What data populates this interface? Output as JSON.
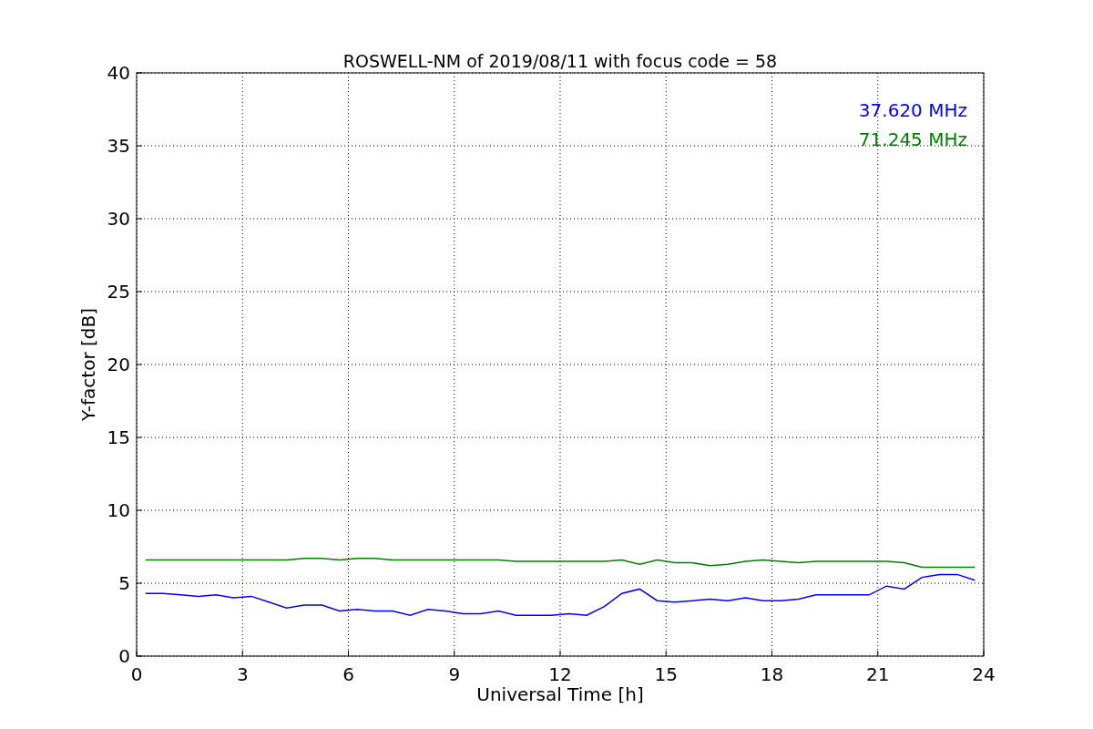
{
  "chart_data": {
    "type": "line",
    "title": "ROSWELL-NM of 2019/08/11 with focus code = 58",
    "xlabel": "Universal Time [h]",
    "ylabel": "Y-factor [dB]",
    "x": [
      0.25,
      0.75,
      1.25,
      1.75,
      2.25,
      2.75,
      3.25,
      3.75,
      4.25,
      4.75,
      5.25,
      5.75,
      6.25,
      6.75,
      7.25,
      7.75,
      8.25,
      8.75,
      9.25,
      9.75,
      10.25,
      10.75,
      11.25,
      11.75,
      12.25,
      12.75,
      13.25,
      13.75,
      14.25,
      14.75,
      15.25,
      15.75,
      16.25,
      16.75,
      17.25,
      17.75,
      18.25,
      18.75,
      19.25,
      20.75,
      21.25,
      21.75,
      22.25,
      22.75,
      23.25,
      23.75
    ],
    "series": [
      {
        "name": "37.620 MHz",
        "color": "#0000ff",
        "values": [
          4.3,
          4.3,
          4.2,
          4.1,
          4.2,
          4.0,
          4.1,
          3.7,
          3.3,
          3.5,
          3.5,
          3.1,
          3.2,
          3.1,
          3.1,
          2.8,
          3.2,
          3.1,
          2.9,
          2.9,
          3.1,
          2.8,
          2.8,
          2.8,
          2.9,
          2.8,
          3.4,
          4.3,
          4.6,
          3.8,
          3.7,
          3.8,
          3.9,
          3.8,
          4.0,
          3.8,
          3.8,
          3.9,
          4.2,
          4.2,
          4.8,
          4.6,
          5.4,
          5.6,
          5.6,
          5.2
        ]
      },
      {
        "name": "71.245 MHz",
        "color": "#008000",
        "values": [
          6.6,
          6.6,
          6.6,
          6.6,
          6.6,
          6.6,
          6.6,
          6.6,
          6.6,
          6.7,
          6.7,
          6.6,
          6.7,
          6.7,
          6.6,
          6.6,
          6.6,
          6.6,
          6.6,
          6.6,
          6.6,
          6.5,
          6.5,
          6.5,
          6.5,
          6.5,
          6.5,
          6.6,
          6.3,
          6.6,
          6.4,
          6.4,
          6.2,
          6.3,
          6.5,
          6.6,
          6.5,
          6.4,
          6.5,
          6.5,
          6.5,
          6.4,
          6.1,
          6.1,
          6.1,
          6.1
        ]
      }
    ],
    "xlim": [
      0,
      24
    ],
    "ylim": [
      0,
      40
    ],
    "xticks": [
      0,
      3,
      6,
      9,
      12,
      15,
      18,
      21,
      24
    ],
    "yticks": [
      0,
      5,
      10,
      15,
      20,
      25,
      30,
      35,
      40
    ],
    "grid": true
  }
}
